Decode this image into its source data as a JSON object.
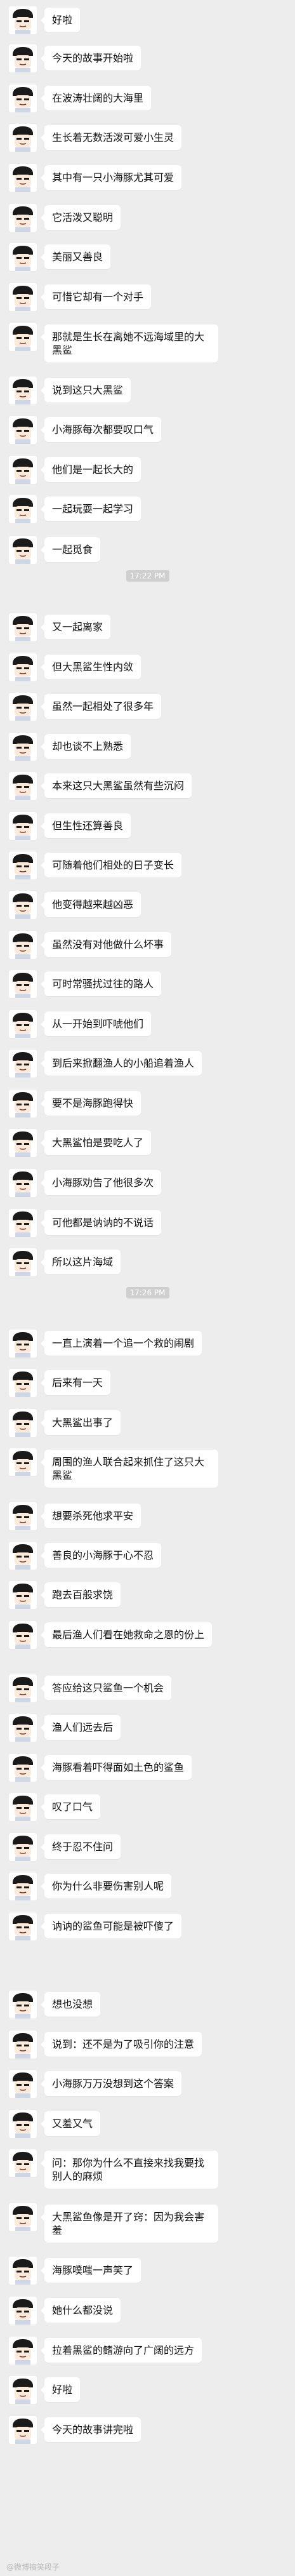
{
  "messages": [
    "好啦",
    "今天的故事开始啦",
    "在波涛壮阔的大海里",
    "生长着无数活泼可爱小生灵",
    "其中有一只小海豚尤其可爱",
    "它活泼又聪明",
    "美丽又善良",
    "可惜它却有一个对手",
    "那就是生长在离她不远海域里的大黑鲨",
    "说到这只大黑鲨",
    "小海豚每次都要叹口气",
    "他们是一起长大的",
    "一起玩耍一起学习",
    "一起觅食",
    "又一起离家",
    "但大黑鲨生性内敛",
    "虽然一起相处了很多年",
    "却也谈不上熟悉",
    "本来这只大黑鲨虽然有些沉闷",
    "但生性还算善良",
    "可随着他们相处的日子变长",
    "他变得越来越凶恶",
    "虽然没有对他做什么坏事",
    "可时常骚扰过往的路人",
    "从一开始到吓唬他们",
    "到后来掀翻渔人的小船追着渔人",
    "要不是海豚跑得快",
    "大黑鲨怕是要吃人了",
    "小海豚劝告了他很多次",
    "可他都是讷讷的不说话",
    "所以这片海域",
    "一直上演着一个追一个救的闹剧",
    "后来有一天",
    "大黑鲨出事了",
    "周围的渔人联合起来抓住了这只大黑鲨",
    "想要杀死他求平安",
    "善良的小海豚于心不忍",
    "跑去百般求饶",
    "最后渔人们看在她救命之恩的份上",
    "答应给这只鲨鱼一个机会",
    "渔人们远去后",
    "海豚看着吓得面如土色的鲨鱼",
    "叹了口气",
    "终于忍不住问",
    "你为什么非要伤害别人呢",
    "讷讷的鲨鱼可能是被吓傻了",
    "想也没想",
    "说到：还不是为了吸引你的注意",
    "小海豚万万没想到这个答案",
    "又羞又气",
    "问：那你为什么不直接来找我要找别人的麻烦",
    "大黑鲨鱼像是开了窍：因为我会害羞",
    "海豚噗嗤一声笑了",
    "她什么都没说",
    "拉着黑鲨的鳍游向了广阔的远方",
    "好啦",
    "今天的故事讲完啦"
  ],
  "timestamps": [
    "17:22 PM",
    "17:26 PM"
  ],
  "watermark": "@微博搞笑段子",
  "colors": {
    "background": "#ededed",
    "bubble": "#ffffff",
    "text": "#111111"
  }
}
